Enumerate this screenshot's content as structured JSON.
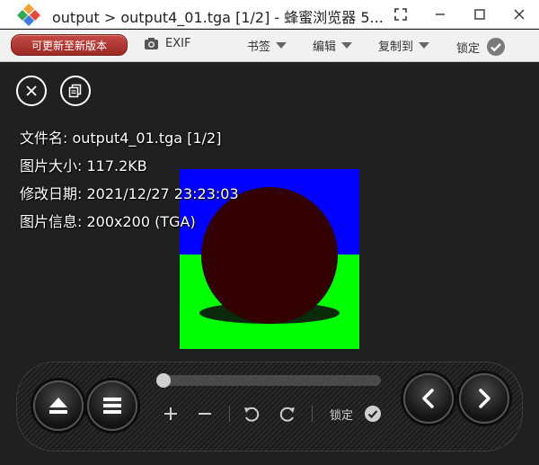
{
  "window": {
    "title": "output > output4_01.tga [1/2] - 蜂蜜浏览器 5...",
    "controls": [
      "fullscreen-icon",
      "minimize-icon",
      "maximize-icon",
      "close-icon"
    ]
  },
  "toolbar": {
    "update_label": "可更新至新版本",
    "exif_label": "EXIF",
    "bookmarks_label": "书签",
    "edit_label": "编辑",
    "copy_to_label": "复制到",
    "lock_label": "锁定"
  },
  "viewer": {
    "info": {
      "filename": "文件名: output4_01.tga [1/2]",
      "size": "图片大小: 117.2KB",
      "modified": "修改日期: 2021/12/27 23:23:03",
      "dimensions": "图片信息: 200x200 (TGA)"
    },
    "image": {
      "sky_color": "#0000ff",
      "ground_color": "#00ff00",
      "sphere_color": "#330000",
      "shadow_color": "#0a2a0a"
    },
    "controls": {
      "lock_label": "锁定",
      "seek_position": 0
    }
  },
  "colors": {
    "update_button": "#b03a35",
    "background": "#202020"
  }
}
